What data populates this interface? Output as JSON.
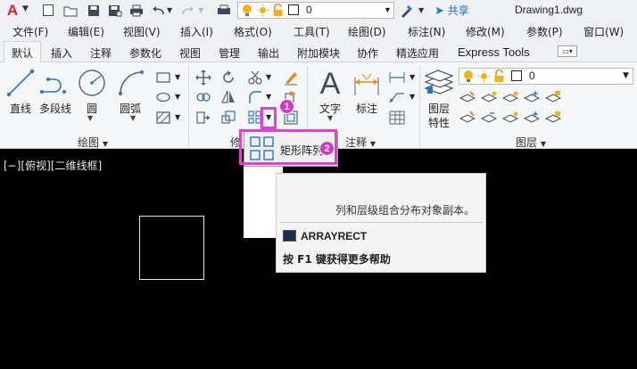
{
  "app": {
    "logo_letter": "A",
    "document_title": "Drawing1.dwg",
    "share_label": "共享",
    "layer_value": "0"
  },
  "menu": [
    {
      "label": "文件(F)"
    },
    {
      "label": "编辑(E)"
    },
    {
      "label": "视图(V)"
    },
    {
      "label": "插入(I)"
    },
    {
      "label": "格式(O)"
    },
    {
      "label": "工具(T)"
    },
    {
      "label": "绘图(D)"
    },
    {
      "label": "标注(N)"
    },
    {
      "label": "修改(M)"
    },
    {
      "label": "参数(P)"
    },
    {
      "label": "窗口(W)"
    }
  ],
  "tabs": [
    {
      "label": "默认",
      "active": true
    },
    {
      "label": "插入"
    },
    {
      "label": "注释"
    },
    {
      "label": "参数化"
    },
    {
      "label": "视图"
    },
    {
      "label": "管理"
    },
    {
      "label": "输出"
    },
    {
      "label": "附加模块"
    },
    {
      "label": "协作"
    },
    {
      "label": "精选应用"
    },
    {
      "label": "Express Tools"
    }
  ],
  "ribbon": {
    "draw_tools": [
      {
        "label": "直线",
        "icon": "line-icon"
      },
      {
        "label": "多段线",
        "icon": "polyline-icon"
      },
      {
        "label": "圆",
        "icon": "circle-icon"
      },
      {
        "label": "圆弧",
        "icon": "arc-icon"
      }
    ],
    "draw_group": "绘图",
    "modify_group": "修",
    "annotation_tools": [
      {
        "label": "文字",
        "icon": "text-icon"
      },
      {
        "label": "标注",
        "icon": "dimension-icon"
      }
    ],
    "annotation_group": "注释",
    "layer_tool": {
      "line1": "图层",
      "line2": "特性"
    },
    "layer_value": "0",
    "layer_group": "图层"
  },
  "flyout": {
    "item_label": "矩形阵列"
  },
  "tooltip": {
    "description": "列和层级组合分布对象副本。",
    "command": "ARRAYRECT",
    "help": "按 F1 键获得更多帮助"
  },
  "callouts": [
    {
      "number": "1"
    },
    {
      "number": "2"
    }
  ],
  "viewport": {
    "label": "[−][俯视][二维线框]"
  },
  "colors": {
    "accent_marker": "#e040d8",
    "badge": "#d338c9",
    "logo": "#d6262c",
    "canvas": "#000000",
    "share": "#1d6fd1"
  }
}
